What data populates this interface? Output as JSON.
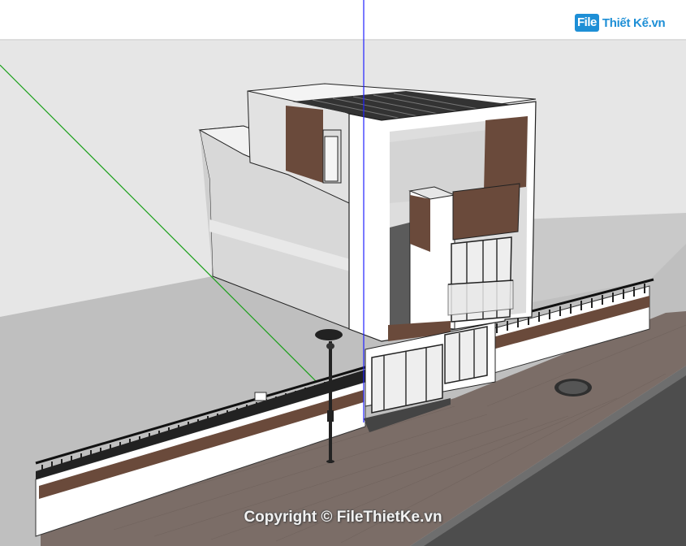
{
  "watermark": {
    "logo_mark": "File",
    "logo_text": "Thiết Kế.vn",
    "copyright": "Copyright © FileThietKe.vn"
  },
  "colors": {
    "sky_band": "#e9e9e9",
    "ground": "#bdbdbd",
    "wall_white": "#ffffff",
    "wood": "#6b4a3a",
    "pavement": "#7a6b65",
    "road": "#4a4a4a",
    "axis_green": "#1aa01a",
    "axis_blue": "#1a1aff"
  }
}
